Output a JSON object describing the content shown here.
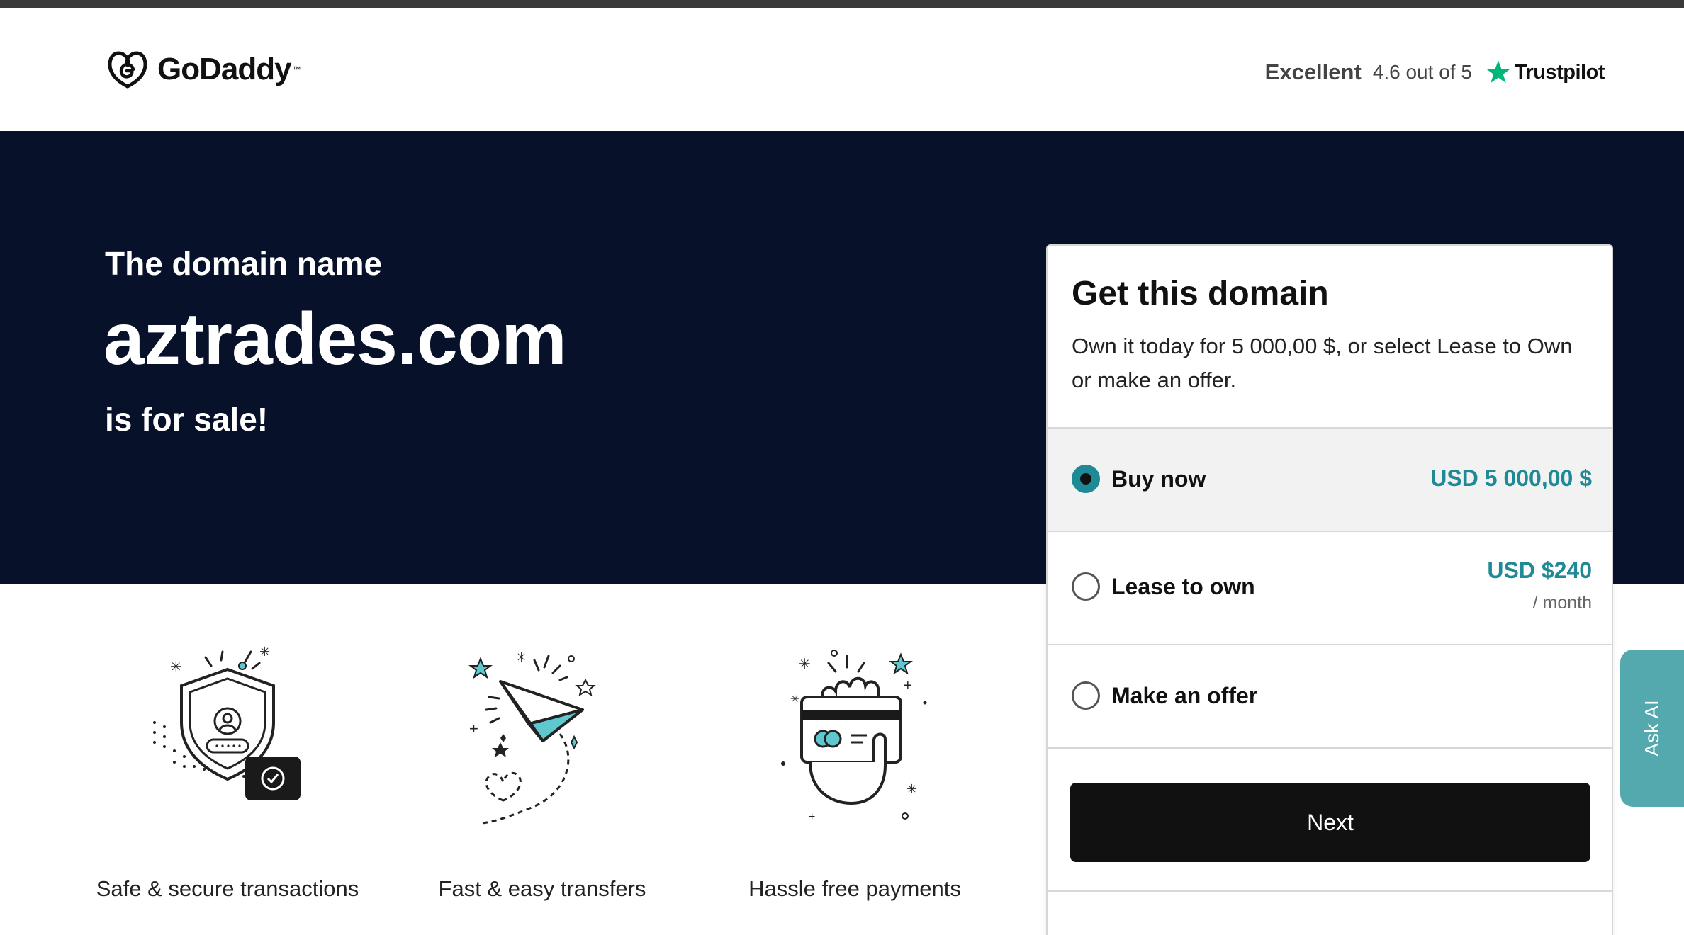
{
  "header": {
    "brand": "GoDaddy",
    "trustpilot": {
      "summary": "Excellent",
      "rating": "4.6 out of 5",
      "brand": "Trustpilot"
    }
  },
  "hero": {
    "pre": "The domain name",
    "domain": "aztrades.com",
    "post": "is for sale!"
  },
  "features": [
    {
      "label": "Safe & secure transactions",
      "icon": "shield-icon"
    },
    {
      "label": "Fast & easy transfers",
      "icon": "paper-plane-icon"
    },
    {
      "label": "Hassle free payments",
      "icon": "credit-card-hand-icon"
    }
  ],
  "card": {
    "title": "Get this domain",
    "description": "Own it today for 5 000,00 $, or select Lease to Own or make an offer.",
    "options": {
      "buy": {
        "label": "Buy now",
        "price": "USD 5 000,00 $",
        "selected": true
      },
      "lease": {
        "label": "Lease to own",
        "price": "USD $240",
        "unit": "/ month",
        "selected": false
      },
      "offer": {
        "label": "Make an offer",
        "selected": false
      }
    },
    "next_label": "Next"
  },
  "ask_ai": "Ask AI",
  "colors": {
    "hero_bg": "#07112a",
    "accent": "#1f8a96",
    "ask_ai_bg": "#54a9ae",
    "trustpilot_green": "#00b67a",
    "icon_teal": "#5fc8cf"
  }
}
